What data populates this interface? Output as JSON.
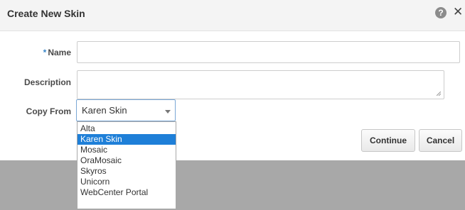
{
  "dialog": {
    "title": "Create New Skin",
    "help_icon_glyph": "?",
    "close_icon_glyph": "✕"
  },
  "form": {
    "required_marker": "*",
    "name_label": "Name",
    "name_value": "",
    "description_label": "Description",
    "description_value": "",
    "copy_from_label": "Copy From",
    "copy_from_selected": "Karen Skin",
    "copy_from_options": [
      "Alta",
      "Karen Skin",
      "Mosaic",
      "OraMosaic",
      "Skyros",
      "Unicorn",
      "WebCenter Portal"
    ]
  },
  "buttons": {
    "continue_label": "Continue",
    "cancel_label": "Cancel"
  },
  "colors": {
    "accent": "#1e7fd8",
    "required_star": "#3a86c8",
    "overlay": "#a8a8a8"
  }
}
